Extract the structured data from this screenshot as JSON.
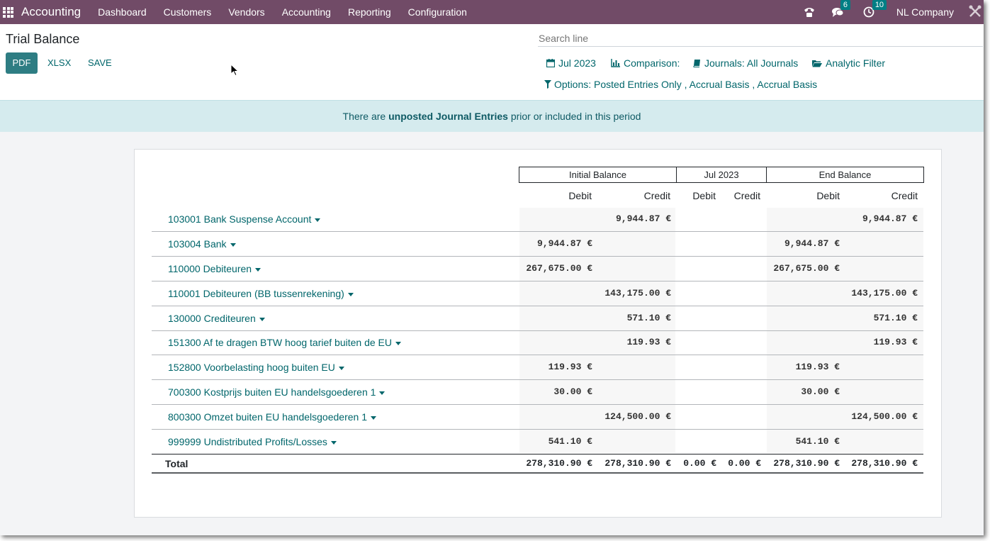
{
  "navbar": {
    "app_name": "Accounting",
    "menu": [
      "Dashboard",
      "Customers",
      "Vendors",
      "Accounting",
      "Reporting",
      "Configuration"
    ],
    "messages_badge": "6",
    "activities_badge": "10",
    "company": "NL Company"
  },
  "page": {
    "title": "Trial Balance",
    "buttons": {
      "pdf": "PDF",
      "xlsx": "XLSX",
      "save": "SAVE"
    },
    "search_placeholder": "Search line"
  },
  "filters": {
    "date": "Jul 2023",
    "comparison": "Comparison:",
    "journals": "Journals: All Journals",
    "analytic": "Analytic Filter",
    "options": "Options: Posted Entries Only , Accrual Basis , Accrual Basis"
  },
  "alert": {
    "prefix": "There are",
    "link": "unposted Journal Entries",
    "suffix": "prior or included in this period"
  },
  "report": {
    "groups": [
      "Initial Balance",
      "Jul 2023",
      "End Balance"
    ],
    "col_debit": "Debit",
    "col_credit": "Credit",
    "rows": [
      {
        "account": "103001 Bank Suspense Account",
        "init_debit": "",
        "init_credit": "9,944.87 €",
        "per_debit": "",
        "per_credit": "",
        "end_debit": "",
        "end_credit": "9,944.87 €"
      },
      {
        "account": "103004 Bank",
        "init_debit": "9,944.87 €",
        "init_credit": "",
        "per_debit": "",
        "per_credit": "",
        "end_debit": "9,944.87 €",
        "end_credit": ""
      },
      {
        "account": "110000 Debiteuren",
        "init_debit": "267,675.00 €",
        "init_credit": "",
        "per_debit": "",
        "per_credit": "",
        "end_debit": "267,675.00 €",
        "end_credit": ""
      },
      {
        "account": "110001 Debiteuren (BB tussenrekening)",
        "init_debit": "",
        "init_credit": "143,175.00 €",
        "per_debit": "",
        "per_credit": "",
        "end_debit": "",
        "end_credit": "143,175.00 €"
      },
      {
        "account": "130000 Crediteuren",
        "init_debit": "",
        "init_credit": "571.10 €",
        "per_debit": "",
        "per_credit": "",
        "end_debit": "",
        "end_credit": "571.10 €"
      },
      {
        "account": "151300 Af te dragen BTW hoog tarief buiten de EU",
        "init_debit": "",
        "init_credit": "119.93 €",
        "per_debit": "",
        "per_credit": "",
        "end_debit": "",
        "end_credit": "119.93 €"
      },
      {
        "account": "152800 Voorbelasting hoog buiten EU",
        "init_debit": "119.93 €",
        "init_credit": "",
        "per_debit": "",
        "per_credit": "",
        "end_debit": "119.93 €",
        "end_credit": ""
      },
      {
        "account": "700300 Kostprijs buiten EU handelsgoederen 1",
        "init_debit": "30.00 €",
        "init_credit": "",
        "per_debit": "",
        "per_credit": "",
        "end_debit": "30.00 €",
        "end_credit": ""
      },
      {
        "account": "800300 Omzet buiten EU handelsgoederen 1",
        "init_debit": "",
        "init_credit": "124,500.00 €",
        "per_debit": "",
        "per_credit": "",
        "end_debit": "",
        "end_credit": "124,500.00 €"
      },
      {
        "account": "999999 Undistributed Profits/Losses",
        "init_debit": "541.10 €",
        "init_credit": "",
        "per_debit": "",
        "per_credit": "",
        "end_debit": "541.10 €",
        "end_credit": ""
      }
    ],
    "total": {
      "label": "Total",
      "init_debit": "278,310.90 €",
      "init_credit": "278,310.90 €",
      "per_debit": "0.00 €",
      "per_credit": "0.00 €",
      "end_debit": "278,310.90 €",
      "end_credit": "278,310.90 €"
    }
  }
}
